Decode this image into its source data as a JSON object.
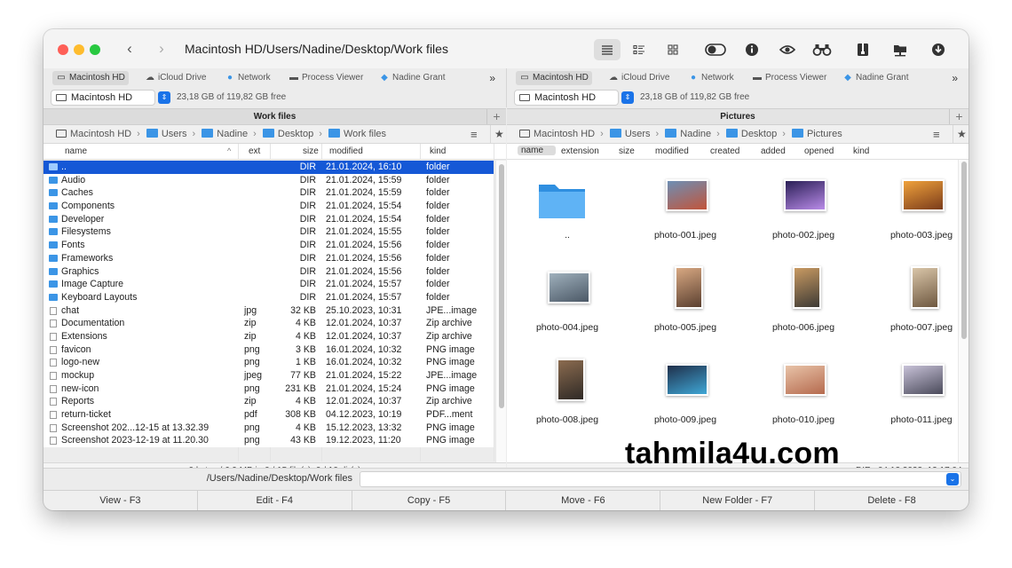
{
  "window": {
    "title": "Macintosh HD/Users/Nadine/Desktop/Work files"
  },
  "favorites": [
    {
      "label": "Macintosh HD",
      "icon": "hard-drive-icon",
      "selected": true
    },
    {
      "label": "iCloud Drive",
      "icon": "cloud-icon"
    },
    {
      "label": "Network",
      "icon": "globe-icon"
    },
    {
      "label": "Process Viewer",
      "icon": "process-icon"
    },
    {
      "label": "Nadine Grant",
      "icon": "user-folder-icon"
    }
  ],
  "favorites_more": "»",
  "left": {
    "drive": "Macintosh HD",
    "free": "23,18 GB of 119,82 GB free",
    "panel_title": "Work files",
    "breadcrumb": [
      "Macintosh HD",
      "Users",
      "Nadine",
      "Desktop",
      "Work files"
    ],
    "columns": {
      "name": "name",
      "ext": "ext",
      "size": "size",
      "modified": "modified",
      "kind": "kind"
    },
    "rows": [
      {
        "name": "..",
        "ext": "",
        "size": "DIR",
        "modified": "21.01.2024, 16:10",
        "kind": "folder",
        "type": "folder"
      },
      {
        "name": "Audio",
        "ext": "",
        "size": "DIR",
        "modified": "21.01.2024, 15:59",
        "kind": "folder",
        "type": "folder"
      },
      {
        "name": "Caches",
        "ext": "",
        "size": "DIR",
        "modified": "21.01.2024, 15:59",
        "kind": "folder",
        "type": "folder"
      },
      {
        "name": "Components",
        "ext": "",
        "size": "DIR",
        "modified": "21.01.2024, 15:54",
        "kind": "folder",
        "type": "folder"
      },
      {
        "name": "Developer",
        "ext": "",
        "size": "DIR",
        "modified": "21.01.2024, 15:54",
        "kind": "folder",
        "type": "folder"
      },
      {
        "name": "Filesystems",
        "ext": "",
        "size": "DIR",
        "modified": "21.01.2024, 15:55",
        "kind": "folder",
        "type": "folder"
      },
      {
        "name": "Fonts",
        "ext": "",
        "size": "DIR",
        "modified": "21.01.2024, 15:56",
        "kind": "folder",
        "type": "folder"
      },
      {
        "name": "Frameworks",
        "ext": "",
        "size": "DIR",
        "modified": "21.01.2024, 15:56",
        "kind": "folder",
        "type": "folder"
      },
      {
        "name": "Graphics",
        "ext": "",
        "size": "DIR",
        "modified": "21.01.2024, 15:56",
        "kind": "folder",
        "type": "folder"
      },
      {
        "name": "Image Capture",
        "ext": "",
        "size": "DIR",
        "modified": "21.01.2024, 15:57",
        "kind": "folder",
        "type": "folder"
      },
      {
        "name": "Keyboard Layouts",
        "ext": "",
        "size": "DIR",
        "modified": "21.01.2024, 15:57",
        "kind": "folder",
        "type": "folder"
      },
      {
        "name": "chat",
        "ext": "jpg",
        "size": "32 KB",
        "modified": "25.10.2023, 10:31",
        "kind": "JPE...image",
        "type": "file"
      },
      {
        "name": "Documentation",
        "ext": "zip",
        "size": "4 KB",
        "modified": "12.01.2024, 10:37",
        "kind": "Zip archive",
        "type": "file"
      },
      {
        "name": "Extensions",
        "ext": "zip",
        "size": "4 KB",
        "modified": "12.01.2024, 10:37",
        "kind": "Zip archive",
        "type": "file"
      },
      {
        "name": "favicon",
        "ext": "png",
        "size": "3 KB",
        "modified": "16.01.2024, 10:32",
        "kind": "PNG image",
        "type": "file"
      },
      {
        "name": "logo-new",
        "ext": "png",
        "size": "1 KB",
        "modified": "16.01.2024, 10:32",
        "kind": "PNG image",
        "type": "file"
      },
      {
        "name": "mockup",
        "ext": "jpeg",
        "size": "77 KB",
        "modified": "21.01.2024, 15:22",
        "kind": "JPE...image",
        "type": "file"
      },
      {
        "name": "new-icon",
        "ext": "png",
        "size": "231 KB",
        "modified": "21.01.2024, 15:24",
        "kind": "PNG image",
        "type": "file"
      },
      {
        "name": "Reports",
        "ext": "zip",
        "size": "4 KB",
        "modified": "12.01.2024, 10:37",
        "kind": "Zip archive",
        "type": "file"
      },
      {
        "name": "return-ticket",
        "ext": "pdf",
        "size": "308 KB",
        "modified": "04.12.2023, 10:19",
        "kind": "PDF...ment",
        "type": "file"
      },
      {
        "name": "Screenshot 202...12-15 at 13.32.39",
        "ext": "png",
        "size": "4 KB",
        "modified": "15.12.2023, 13:32",
        "kind": "PNG image",
        "type": "file"
      },
      {
        "name": "Screenshot 2023-12-19 at 11.20.30",
        "ext": "png",
        "size": "43 KB",
        "modified": "19.12.2023, 11:20",
        "kind": "PNG image",
        "type": "file"
      }
    ],
    "status": "0 bytes / 6,9 MB in 0 / 15 file(s). 0 / 10 dir(s)"
  },
  "right": {
    "drive": "Macintosh HD",
    "free": "23,18 GB of 119,82 GB free",
    "panel_title": "Pictures",
    "breadcrumb": [
      "Macintosh HD",
      "Users",
      "Nadine",
      "Desktop",
      "Pictures"
    ],
    "columns": [
      "name",
      "extension",
      "size",
      "modified",
      "created",
      "added",
      "opened",
      "kind"
    ],
    "items": [
      {
        "name": "..",
        "kind": "folder"
      },
      {
        "name": "photo-001.jpeg",
        "colors": [
          "#6d8fb5",
          "#c2543a"
        ],
        "tall": false
      },
      {
        "name": "photo-002.jpeg",
        "colors": [
          "#2a1f56",
          "#b98be8"
        ],
        "tall": false
      },
      {
        "name": "photo-003.jpeg",
        "colors": [
          "#f0a23c",
          "#7a3b1a"
        ],
        "tall": false
      },
      {
        "name": "photo-004.jpeg",
        "colors": [
          "#9fb0bc",
          "#4b5866"
        ],
        "tall": false
      },
      {
        "name": "photo-005.jpeg",
        "colors": [
          "#d8a882",
          "#5b4030"
        ],
        "tall": true
      },
      {
        "name": "photo-006.jpeg",
        "colors": [
          "#c99a62",
          "#3d3a35"
        ],
        "tall": true
      },
      {
        "name": "photo-007.jpeg",
        "colors": [
          "#d9c5a8",
          "#6e5840"
        ],
        "tall": true
      },
      {
        "name": "photo-008.jpeg",
        "colors": [
          "#8b6b4f",
          "#2f2a26"
        ],
        "tall": true
      },
      {
        "name": "photo-009.jpeg",
        "colors": [
          "#1f2f4a",
          "#3fa7d6"
        ],
        "tall": false
      },
      {
        "name": "photo-010.jpeg",
        "colors": [
          "#e8c3a8",
          "#b56a4e"
        ],
        "tall": false
      },
      {
        "name": "photo-011.jpeg",
        "colors": [
          "#c8c2d8",
          "#4a4a5a"
        ],
        "tall": false
      }
    ],
    "status_left": "..",
    "status_kind": "DIR",
    "status_date": "04.12.2023, 12:17:04"
  },
  "command": {
    "path": "/Users/Nadine/Desktop/Work files",
    "value": ""
  },
  "fkeys": [
    "View - F3",
    "Edit - F4",
    "Copy - F5",
    "Move - F6",
    "New Folder - F7",
    "Delete - F8"
  ],
  "watermark": "tahmila4u.com",
  "colors": {
    "selection": "#1558d6",
    "folder": "#3b95e6",
    "accent": "#1a73e8"
  }
}
